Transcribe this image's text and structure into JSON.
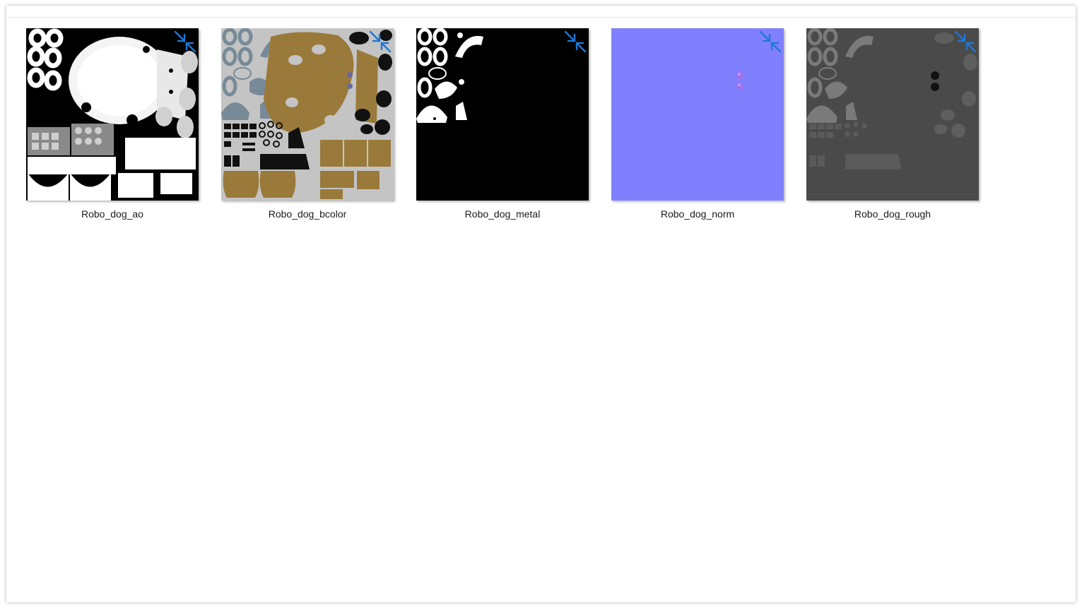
{
  "explorer": {
    "files": [
      {
        "name": "Robo_dog_ao",
        "thumbnail_icon": "ao-texture-icon"
      },
      {
        "name": "Robo_dog_bcolor",
        "thumbnail_icon": "basecolor-texture-icon"
      },
      {
        "name": "Robo_dog_metal",
        "thumbnail_icon": "metal-texture-icon"
      },
      {
        "name": "Robo_dog_norm",
        "thumbnail_icon": "normal-texture-icon"
      },
      {
        "name": "Robo_dog_rough",
        "thumbnail_icon": "roughness-texture-icon"
      }
    ],
    "overlay_icon": "compress-arrows-icon",
    "colors": {
      "accent": "#1e78d6",
      "normal_map": "#8080ff",
      "bcolor_bg": "#c4c4c4",
      "bcolor_brown": "#9a7a3a",
      "bcolor_grey": "#788a98",
      "rough_bg": "#4a4a4a"
    }
  }
}
